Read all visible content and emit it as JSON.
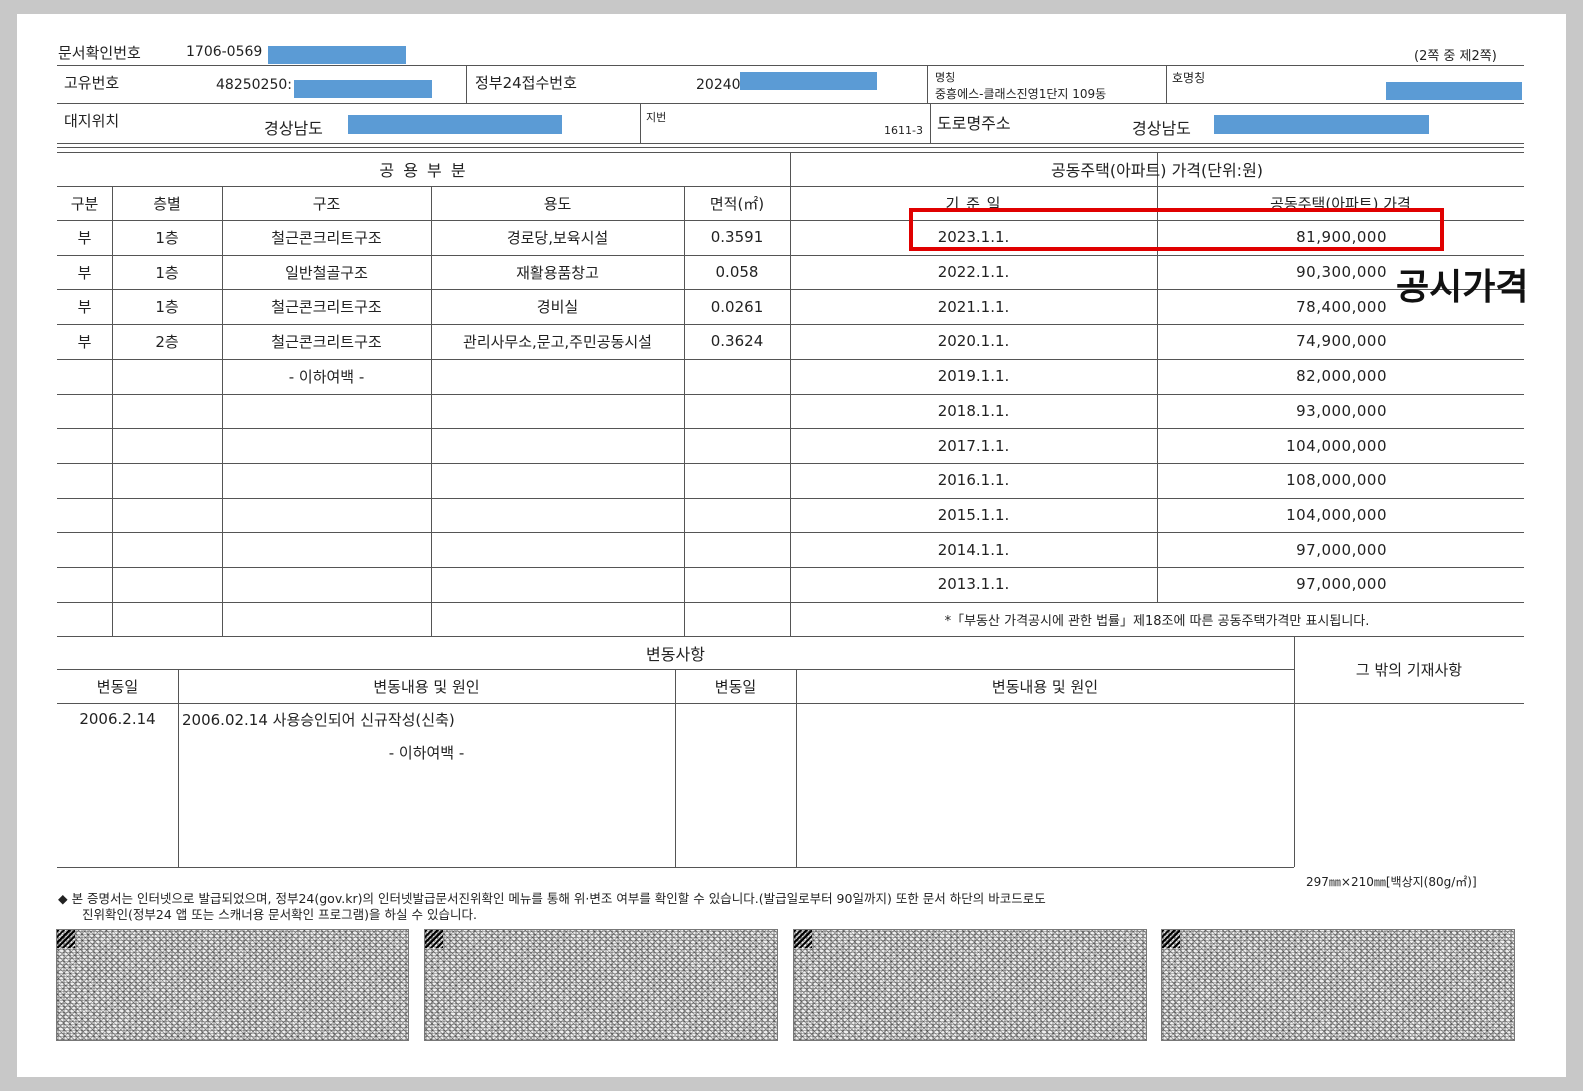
{
  "header": {
    "doc_confirm_label": "문서확인번호",
    "doc_confirm_value": "1706-0569",
    "page_info": "(2쪽 중 제2쪽)"
  },
  "info": {
    "unique_no_label": "고유번호",
    "unique_no_value": "48250250:",
    "gov24_label": "정부24접수번호",
    "gov24_value": "20240",
    "name_label": "명칭",
    "name_value": "중흥에스-클래스진영1단지 109동",
    "room_label": "호명칭",
    "site_label": "대지위치",
    "site_value": "경상남도",
    "lot_label": "지번",
    "lot_value": "1611-3",
    "road_label": "도로명주소",
    "road_value": "경상남도"
  },
  "common": {
    "title": "공 용 부 분",
    "headers": [
      "구분",
      "층별",
      "구조",
      "용도",
      "면적(㎡)"
    ],
    "rows": [
      [
        "부",
        "1층",
        "철근콘크리트구조",
        "경로당,보육시설",
        "0.3591"
      ],
      [
        "부",
        "1층",
        "일반철골구조",
        "재활용품창고",
        "0.058"
      ],
      [
        "부",
        "1층",
        "철근콘크리트구조",
        "경비실",
        "0.0261"
      ],
      [
        "부",
        "2층",
        "철근콘크리트구조",
        "관리사무소,문고,주민공동시설",
        "0.3624"
      ]
    ],
    "blank_marker": "- 이하여백 -"
  },
  "price": {
    "title": "공동주택(아파트) 가격(단위:원)",
    "headers": [
      "기 준 일",
      "공동주택(아파트) 가격"
    ],
    "rows": [
      [
        "2023.1.1.",
        "81,900,000"
      ],
      [
        "2022.1.1.",
        "90,300,000"
      ],
      [
        "2021.1.1.",
        "78,400,000"
      ],
      [
        "2020.1.1.",
        "74,900,000"
      ],
      [
        "2019.1.1.",
        "82,000,000"
      ],
      [
        "2018.1.1.",
        "93,000,000"
      ],
      [
        "2017.1.1.",
        "104,000,000"
      ],
      [
        "2016.1.1.",
        "108,000,000"
      ],
      [
        "2015.1.1.",
        "104,000,000"
      ],
      [
        "2014.1.1.",
        "97,000,000"
      ],
      [
        "2013.1.1.",
        "97,000,000"
      ]
    ],
    "footnote": "*「부동산 가격공시에 관한 법률」제18조에 따른 공동주택가격만 표시됩니다."
  },
  "changes": {
    "title": "변동사항",
    "col1": "변동일",
    "col2": "변동내용 및 원인",
    "col3": "변동일",
    "col4": "변동내용 및 원인",
    "other": "그 밖의 기재사항",
    "entry_date": "2006.2.14",
    "entry_text": "2006.02.14 사용승인되어 신규작성(신축)",
    "blank_marker": "- 이하여백 -"
  },
  "paper_size": "297㎜×210㎜[백상지(80g/㎡)]",
  "notice_line1": "◆ 본 증명서는 인터넷으로 발급되었으며, 정부24(gov.kr)의 인터넷발급문서진위확인 메뉴를 통해 위·변조 여부를 확인할 수 있습니다.(발급일로부터 90일까지) 또한 문서 하단의 바코드로도",
  "notice_line2": "진위확인(정부24 앱 또는 스캐너용 문서확인 프로그램)을 하실 수 있습니다.",
  "annotation": {
    "label": "공시가격",
    "color": "#e00000"
  },
  "redaction_color": "#5b9bd5"
}
